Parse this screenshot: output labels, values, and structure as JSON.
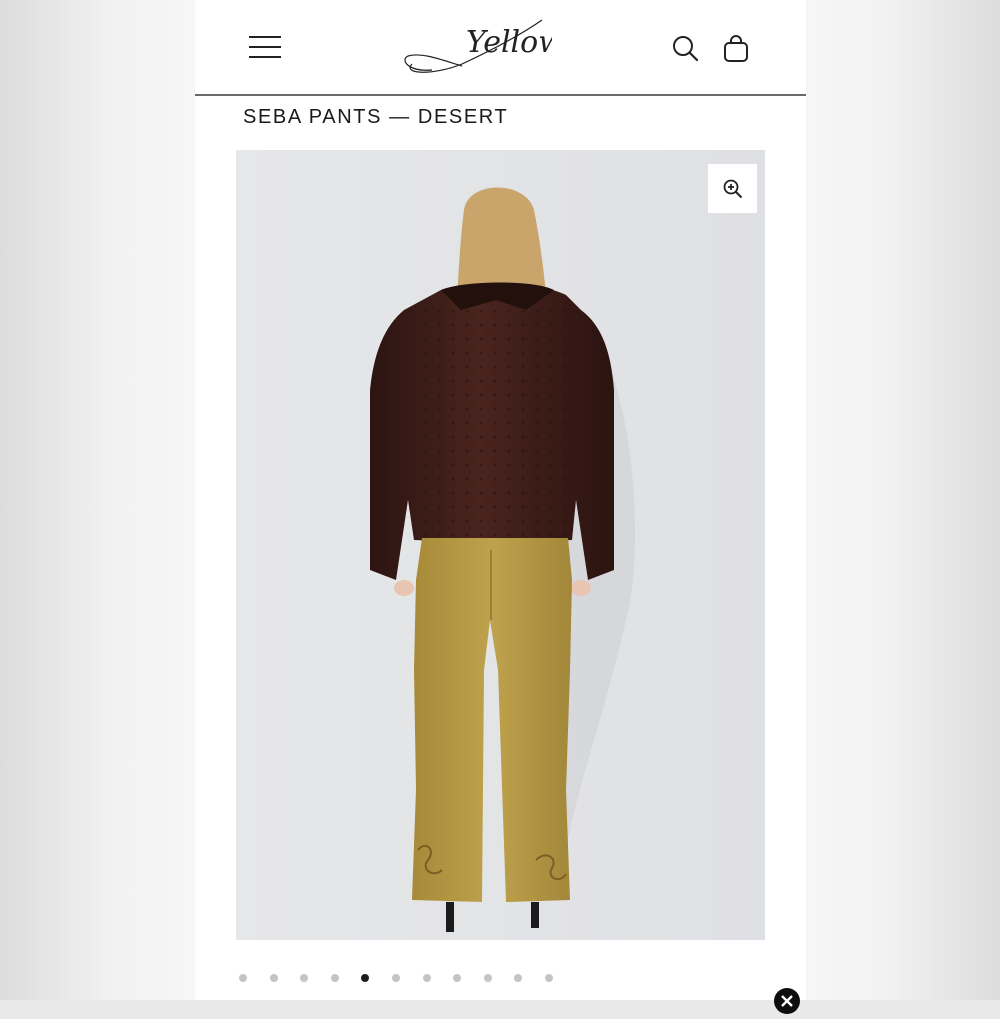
{
  "header": {
    "logo_text": "Yellow",
    "menu_icon": "hamburger-menu-icon",
    "search_icon": "search-icon",
    "cart_icon": "shopping-bag-icon"
  },
  "product": {
    "title": "SEBA PANTS — DESERT"
  },
  "gallery": {
    "image_alt": "Model wearing brown leather jacket and mustard suede flared pants, back view",
    "zoom_icon": "zoom-in-icon",
    "total_images": 11,
    "active_index": 4
  },
  "colors": {
    "jacket": "#3d1c17",
    "pants": "#b79b43",
    "backdrop": "#e4e5e7",
    "hair": "#c9a56c"
  },
  "overlay": {
    "close_icon": "close-icon"
  }
}
